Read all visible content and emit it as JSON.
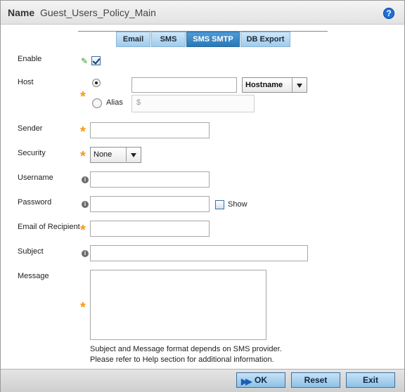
{
  "title": {
    "name_label": "Name",
    "policy_name": "Guest_Users_Policy_Main"
  },
  "tabs": [
    {
      "label": "Email",
      "active": false
    },
    {
      "label": "SMS",
      "active": false
    },
    {
      "label": "SMS SMTP",
      "active": true
    },
    {
      "label": "DB Export",
      "active": false
    }
  ],
  "form": {
    "enable": {
      "label": "Enable",
      "checked": true
    },
    "host": {
      "label": "Host",
      "value": "",
      "type_selected": "Hostname",
      "alias_label": "Alias",
      "alias_value": "$",
      "selected_option": "host"
    },
    "sender": {
      "label": "Sender",
      "value": ""
    },
    "security": {
      "label": "Security",
      "selected": "None"
    },
    "username": {
      "label": "Username",
      "value": ""
    },
    "password": {
      "label": "Password",
      "value": "",
      "show_label": "Show",
      "show_checked": false
    },
    "recipient": {
      "label": "Email of Recipient",
      "value": ""
    },
    "subject": {
      "label": "Subject",
      "value": ""
    },
    "message": {
      "label": "Message",
      "value": ""
    }
  },
  "note": {
    "line1": "Subject and Message format depends on SMS provider.",
    "line2": "Please refer to Help section for additional information."
  },
  "buttons": {
    "ok": "OK",
    "reset": "Reset",
    "exit": "Exit"
  },
  "icons": {
    "help": "help-icon",
    "required": "required-asterisk-icon",
    "info": "info-icon",
    "edit": "pencil-icon"
  },
  "colors": {
    "accent": "#2b78b7",
    "required": "#f39a1c",
    "tab": "#9fcbec"
  }
}
